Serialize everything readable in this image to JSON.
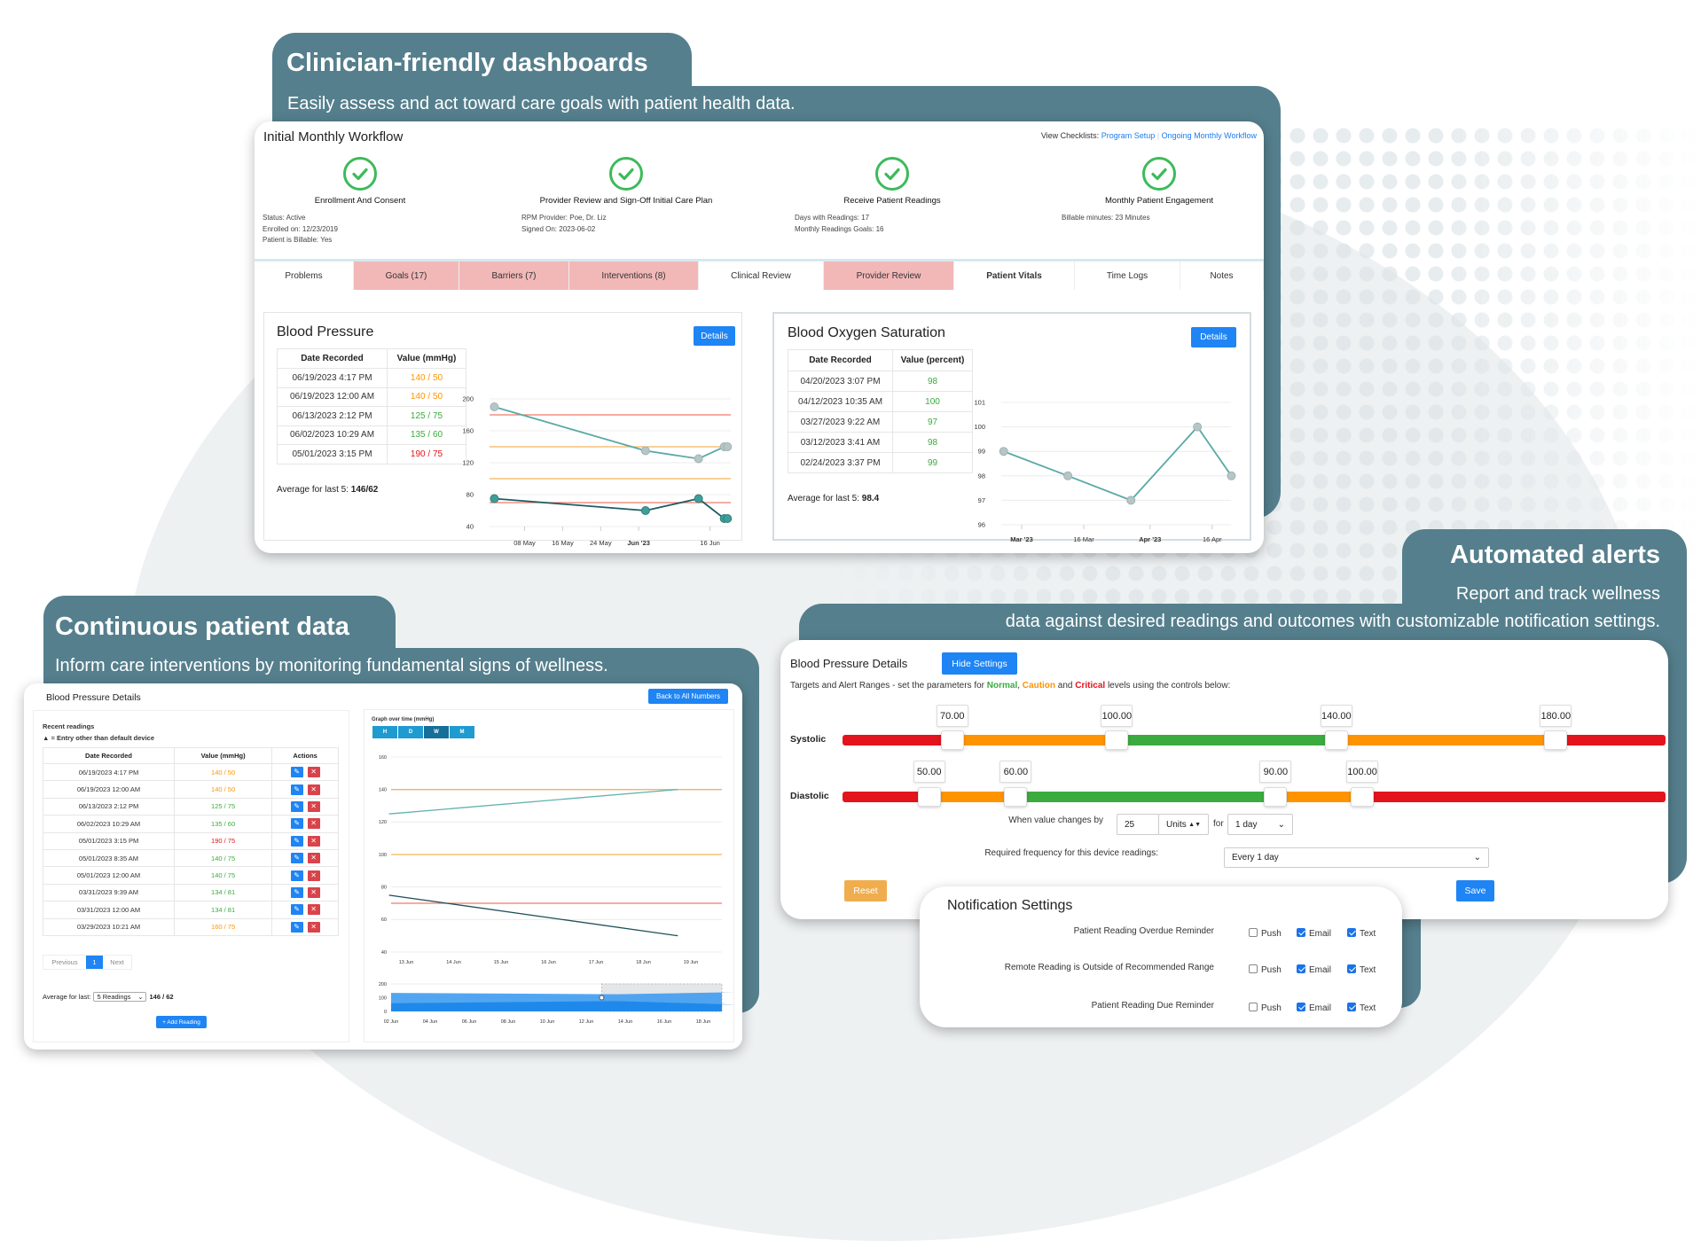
{
  "colors": {
    "banner": "#557f8d",
    "caution": "#ff9400",
    "normal": "#3bab3f",
    "critical": "#e3141c",
    "primary": "#1f84f4",
    "tab_highlight": "#f2b8b8"
  },
  "banners": {
    "dashboards": {
      "title": "Clinician-friendly dashboards",
      "subtitle": "Easily assess and act toward care goals with patient health data."
    },
    "continuous": {
      "title": "Continuous patient data",
      "subtitle": "Inform care interventions by monitoring fundamental signs of wellness."
    },
    "alerts": {
      "title": "Automated alerts",
      "subtitle_line1": "Report and track wellness",
      "subtitle_line2": "data against desired readings and outcomes with customizable notification settings."
    }
  },
  "workflow": {
    "title": "Initial Monthly Workflow",
    "checklists_label": "View Checklists:",
    "checklist_links": [
      "Program Setup",
      "Ongoing Monthly Workflow"
    ],
    "steps": [
      {
        "label": "Enrollment And Consent",
        "status": "complete",
        "icon": "check-circle-icon",
        "details": [
          "Status: Active",
          "Enrolled on: 12/23/2019",
          "Patient is Billable: Yes"
        ]
      },
      {
        "label": "Provider Review and Sign-Off Initial Care Plan",
        "status": "complete",
        "icon": "check-circle-icon",
        "details": [
          "RPM Provider: Poe, Dr. Liz",
          "Signed On: 2023-06-02"
        ]
      },
      {
        "label": "Receive Patient Readings",
        "status": "complete",
        "icon": "check-circle-icon",
        "details": [
          "Days with Readings: 17",
          "Monthly Readings Goals: 16"
        ]
      },
      {
        "label": "Monthly Patient Engagement",
        "status": "complete",
        "icon": "check-circle-icon",
        "details": [
          "Billable minutes: 23 Minutes"
        ]
      }
    ],
    "tabs": [
      {
        "label": "Problems",
        "highlight": false
      },
      {
        "label": "Goals (17)",
        "highlight": true
      },
      {
        "label": "Barriers (7)",
        "highlight": true
      },
      {
        "label": "Interventions (8)",
        "highlight": true
      },
      {
        "label": "Clinical Review",
        "highlight": false
      },
      {
        "label": "Provider Review",
        "highlight": true
      },
      {
        "label": "Patient Vitals",
        "highlight": false,
        "active": true
      },
      {
        "label": "Time Logs",
        "highlight": false
      },
      {
        "label": "Notes",
        "highlight": false
      }
    ]
  },
  "bp_card": {
    "title": "Blood Pressure",
    "details_label": "Details",
    "columns": [
      "Date Recorded",
      "Value (mmHg)"
    ],
    "rows": [
      {
        "date": "06/19/2023 4:17 PM",
        "value": "140 / 50",
        "status": "caution"
      },
      {
        "date": "06/19/2023 12:00 AM",
        "value": "140 / 50",
        "status": "caution"
      },
      {
        "date": "06/13/2023 2:12 PM",
        "value": "125 / 75",
        "status": "normal"
      },
      {
        "date": "06/02/2023 10:29 AM",
        "value": "135 / 60",
        "status": "normal"
      },
      {
        "date": "05/01/2023 3:15 PM",
        "value": "190 / 75",
        "status": "critical"
      }
    ],
    "average_label": "Average for last 5:",
    "average_value": "146/62"
  },
  "spo2_card": {
    "title": "Blood Oxygen Saturation",
    "details_label": "Details",
    "columns": [
      "Date Recorded",
      "Value (percent)"
    ],
    "rows": [
      {
        "date": "04/20/2023 3:07 PM",
        "value": "98",
        "status": "normal"
      },
      {
        "date": "04/12/2023 10:35 AM",
        "value": "100",
        "status": "normal"
      },
      {
        "date": "03/27/2023 9:22 AM",
        "value": "97",
        "status": "normal"
      },
      {
        "date": "03/12/2023 3:41 AM",
        "value": "98",
        "status": "normal"
      },
      {
        "date": "02/24/2023 3:37 PM",
        "value": "99",
        "status": "normal"
      }
    ],
    "average_label": "Average for last 5:",
    "average_value": "98.4"
  },
  "bp_details": {
    "title": "Blood Pressure Details",
    "back_label": "Back to All Numbers",
    "recent_label": "Recent readings",
    "legend_text": "= Entry other than default device",
    "columns": [
      "Date Recorded",
      "Value (mmHg)",
      "Actions"
    ],
    "rows": [
      {
        "date": "06/19/2023 4:17 PM",
        "value": "140 / 50",
        "status": "caution"
      },
      {
        "date": "06/19/2023 12:00 AM",
        "value": "140 / 50",
        "status": "caution"
      },
      {
        "date": "06/13/2023 2:12 PM",
        "value": "125 / 75",
        "status": "normal"
      },
      {
        "date": "06/02/2023 10:29 AM",
        "value": "135 / 60",
        "status": "normal"
      },
      {
        "date": "05/01/2023 3:15 PM",
        "value": "190 / 75",
        "status": "critical"
      },
      {
        "date": "05/01/2023 8:35 AM",
        "value": "140 / 75",
        "status": "normal"
      },
      {
        "date": "05/01/2023 12:00 AM",
        "value": "140 / 75",
        "status": "normal"
      },
      {
        "date": "03/31/2023 9:39 AM",
        "value": "134 / 81",
        "status": "normal"
      },
      {
        "date": "03/31/2023 12:00 AM",
        "value": "134 / 81",
        "status": "normal"
      },
      {
        "date": "03/29/2023 10:21 AM",
        "value": "160 / 75",
        "status": "caution"
      }
    ],
    "pagination": {
      "previous": "Previous",
      "page": "1",
      "next": "Next"
    },
    "average_label": "Average for last:",
    "average_select": "5 Readings",
    "average_value": "146 / 62",
    "add_label": "+ Add Reading",
    "graph_title": "Graph over time (mmHg)",
    "range_buttons": [
      "H",
      "D",
      "W",
      "M"
    ],
    "range_selected": "W"
  },
  "alerts": {
    "title": "Blood Pressure Details",
    "hide_label": "Hide Settings",
    "instructions": {
      "prefix": "Targets and Alert Ranges - set the parameters for ",
      "normal": "Normal",
      "sep1": ", ",
      "caution": "Caution",
      "sep2": " and ",
      "critical": "Critical",
      "suffix": " levels using the controls below:"
    },
    "sliders": [
      {
        "label": "Systolic",
        "min": 50,
        "max": 200,
        "handles": [
          "70.00",
          "100.00",
          "140.00",
          "180.00"
        ]
      },
      {
        "label": "Diastolic",
        "min": 40,
        "max": 135,
        "handles": [
          "50.00",
          "60.00",
          "90.00",
          "100.00"
        ]
      }
    ],
    "change_label": "When value changes by",
    "change_value": "25",
    "change_unit": "Units",
    "for_label": "for",
    "period": "1 day",
    "frequency_label": "Required frequency for this device readings:",
    "frequency_value": "Every 1 day",
    "reset_label": "Reset",
    "save_label": "Save"
  },
  "notifications": {
    "title": "Notification Settings",
    "rows": [
      {
        "label": "Patient Reading Overdue Reminder",
        "push": false,
        "email": true,
        "text": true
      },
      {
        "label": "Remote Reading is Outside of Recommended Range",
        "push": false,
        "email": true,
        "text": true
      },
      {
        "label": "Patient Reading Due Reminder",
        "push": false,
        "email": true,
        "text": true
      }
    ],
    "channel_labels": {
      "push": "Push",
      "email": "Email",
      "text": "Text"
    }
  },
  "chart_data": [
    {
      "type": "line",
      "y_ticks": [
        40,
        80,
        120,
        160,
        200
      ],
      "x": [
        "2023-05-01T15:15",
        "2023-06-02T10:29",
        "2023-06-13T14:12",
        "2023-06-19T00:00",
        "2023-06-19T16:17"
      ],
      "x_ticks": [
        {
          "label": "08 May",
          "date": "2023-05-08"
        },
        {
          "label": "16 May",
          "date": "2023-05-16"
        },
        {
          "label": "24 May",
          "date": "2023-05-24"
        },
        {
          "label": "Jun '23",
          "date": "2023-06-01",
          "bold": true
        },
        {
          "label": "16 Jun",
          "date": "2023-06-16"
        }
      ],
      "series": [
        {
          "values": [
            190,
            135,
            125,
            140,
            140
          ],
          "color": "#5aa9a6"
        },
        {
          "values": [
            75,
            60,
            75,
            50,
            50
          ],
          "color": "#1f5c63"
        }
      ],
      "thresholds": [
        {
          "value": 180,
          "level": "critical"
        },
        {
          "value": 140,
          "level": "caution"
        },
        {
          "value": 100,
          "level": "caution"
        },
        {
          "value": 70,
          "level": "critical"
        }
      ],
      "ylim": [
        40,
        200
      ],
      "grid": true
    },
    {
      "type": "line",
      "y_ticks": [
        96,
        97,
        98,
        99,
        100,
        101
      ],
      "x": [
        "2023-02-24T15:37",
        "2023-03-12T03:41",
        "2023-03-27T09:22",
        "2023-04-12T10:35",
        "2023-04-20T15:07"
      ],
      "x_ticks": [
        {
          "label": "Mar '23",
          "date": "2023-03-01",
          "bold": true
        },
        {
          "label": "16 Mar",
          "date": "2023-03-16"
        },
        {
          "label": "Apr '23",
          "date": "2023-04-01",
          "bold": true
        },
        {
          "label": "16 Apr",
          "date": "2023-04-16"
        }
      ],
      "series": [
        {
          "values": [
            99,
            98,
            97,
            100,
            98
          ],
          "color": "#5aa9a6"
        }
      ],
      "ylim": [
        96,
        101
      ],
      "grid": true
    },
    {
      "type": "line",
      "y_ticks": [
        40,
        60,
        80,
        100,
        120,
        140,
        160
      ],
      "x": [
        "2023-06-13T14:12",
        "2023-06-19T16:17"
      ],
      "x_ticks": [
        {
          "label": "13 Jun",
          "date": "2023-06-13"
        },
        {
          "label": "14 Jun",
          "date": "2023-06-14"
        },
        {
          "label": "15 Jun",
          "date": "2023-06-15"
        },
        {
          "label": "16 Jun",
          "date": "2023-06-16"
        },
        {
          "label": "17 Jun",
          "date": "2023-06-17"
        },
        {
          "label": "18 Jun",
          "date": "2023-06-18"
        },
        {
          "label": "19 Jun",
          "date": "2023-06-19"
        }
      ],
      "series": [
        {
          "values": [
            125,
            140
          ],
          "color": "#5fb3ae"
        },
        {
          "values": [
            75,
            50
          ],
          "color": "#1e4f5a"
        }
      ],
      "thresholds": [
        {
          "value": 140,
          "level": "caution"
        },
        {
          "value": 100,
          "level": "caution"
        },
        {
          "value": 70,
          "level": "critical"
        }
      ],
      "ylim": [
        40,
        160
      ],
      "grid": true
    },
    {
      "type": "area",
      "y_ticks": [
        0,
        100,
        200
      ],
      "x": [
        "2023-06-02T10:29",
        "2023-06-13T14:12",
        "2023-06-19T16:17"
      ],
      "x_ticks": [
        {
          "label": "02 Jun",
          "date": "2023-06-02"
        },
        {
          "label": "04 Jun",
          "date": "2023-06-04"
        },
        {
          "label": "06 Jun",
          "date": "2023-06-06"
        },
        {
          "label": "08 Jun",
          "date": "2023-06-08"
        },
        {
          "label": "10 Jun",
          "date": "2023-06-10"
        },
        {
          "label": "12 Jun",
          "date": "2023-06-12"
        },
        {
          "label": "14 Jun",
          "date": "2023-06-14"
        },
        {
          "label": "16 Jun",
          "date": "2023-06-16"
        },
        {
          "label": "18 Jun",
          "date": "2023-06-18"
        }
      ],
      "series": [
        {
          "values": [
            135,
            125,
            140
          ],
          "color": "#3f9cf0"
        },
        {
          "values": [
            60,
            75,
            50
          ],
          "color": "#1a86ea"
        }
      ],
      "selected_window": {
        "from": "2023-06-12T19:00",
        "to": "2023-06-19T16:17"
      },
      "ylim": [
        0,
        200
      ]
    }
  ]
}
